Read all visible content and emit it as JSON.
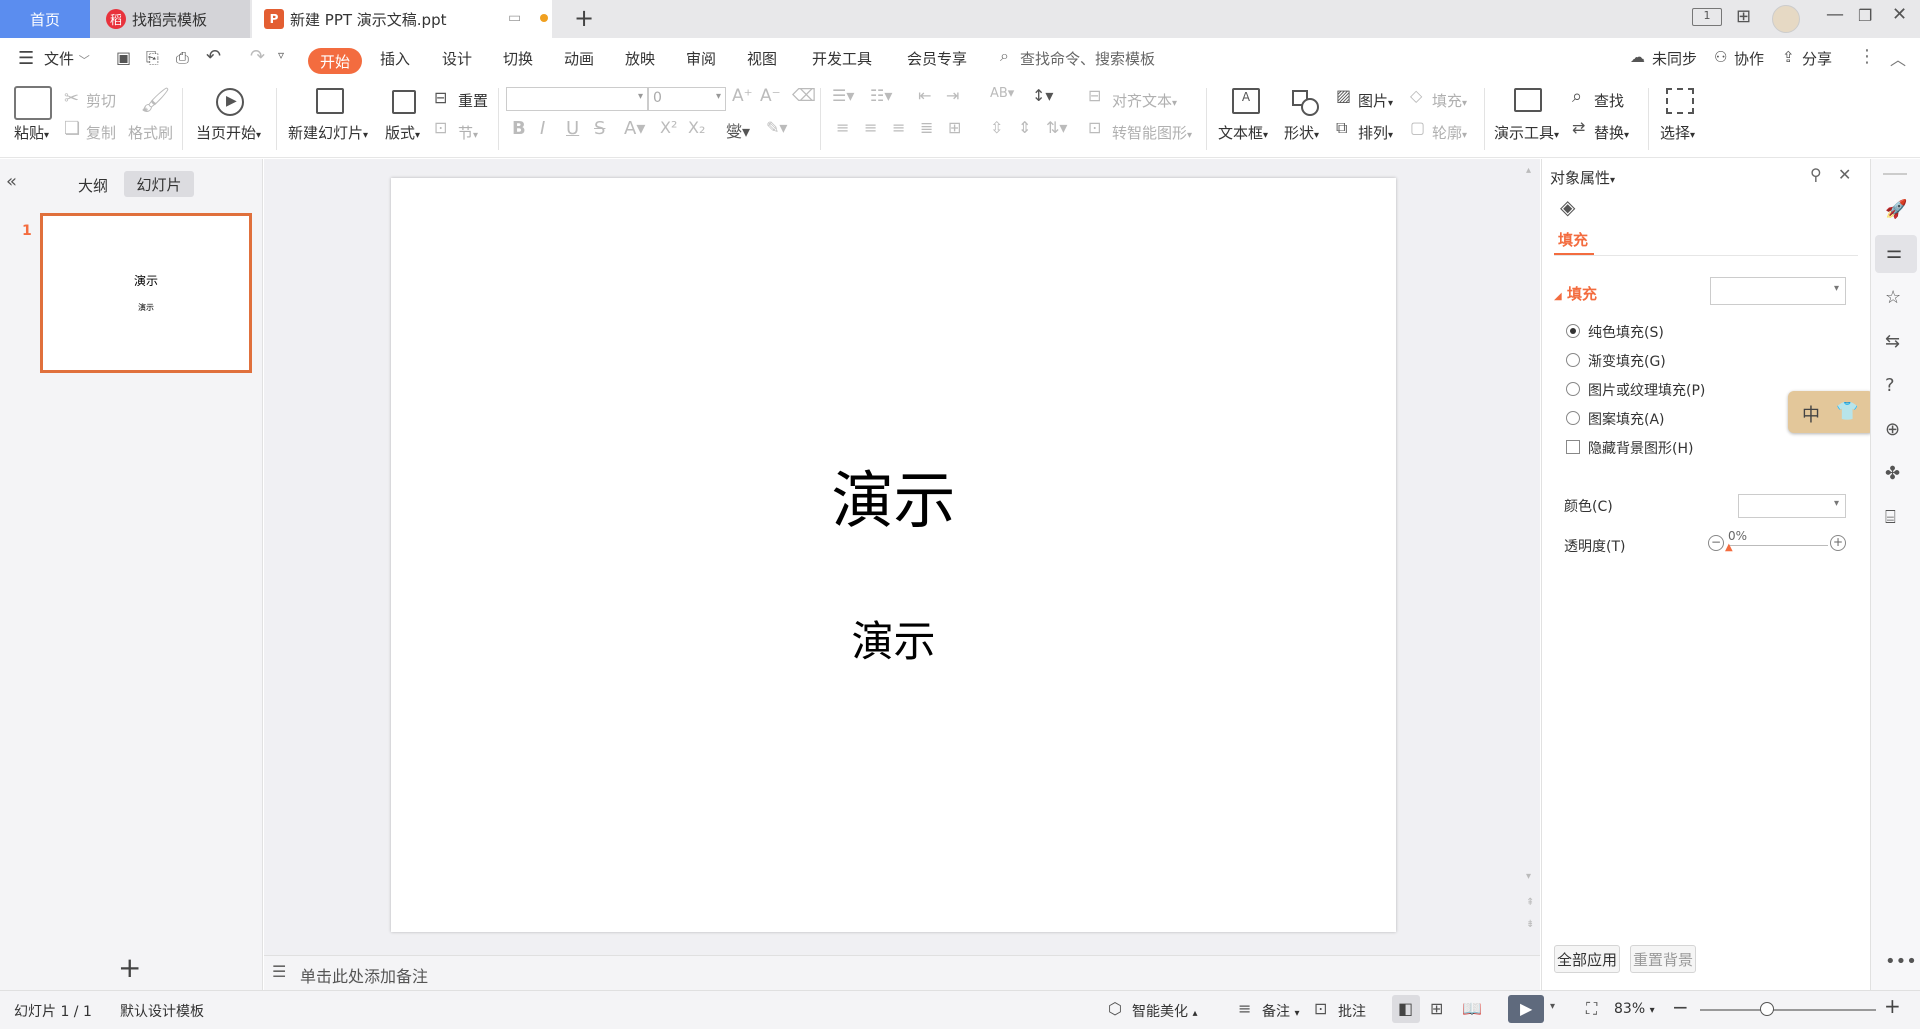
{
  "tabs": {
    "home": "首页",
    "docer": "找稻壳模板",
    "document": "新建 PPT 演示文稿.ppt"
  },
  "menu": {
    "file": "文件",
    "items": [
      "开始",
      "插入",
      "设计",
      "切换",
      "动画",
      "放映",
      "审阅",
      "视图",
      "开发工具",
      "会员专享"
    ],
    "search": "查找命令、搜索模板",
    "sync": "未同步",
    "collab": "协作",
    "share": "分享"
  },
  "ribbon": {
    "paste": "粘贴",
    "cut": "剪切",
    "copy": "复制",
    "format_painter": "格式刷",
    "from_current": "当页开始",
    "new_slide": "新建幻灯片",
    "layout": "版式",
    "section": "节",
    "reset": "重置",
    "font_size": "0",
    "align_text": "对齐文本",
    "smartart": "转智能图形",
    "textbox": "文本框",
    "shape": "形状",
    "arrange": "排列",
    "picture": "图片",
    "fill": "填充",
    "outline": "轮廓",
    "present_tools": "演示工具",
    "find": "查找",
    "replace": "替换",
    "select": "选择"
  },
  "left_panel": {
    "outline_tab": "大纲",
    "slides_tab": "幻灯片",
    "slide_number": "1",
    "thumb_title": "演示",
    "thumb_subtitle": "演示"
  },
  "slide": {
    "title": "演示",
    "subtitle": "演示"
  },
  "notes": {
    "placeholder": "单击此处添加备注"
  },
  "panel": {
    "header": "对象属性",
    "fill_tab": "填充",
    "fill_section": "填充",
    "options": [
      "纯色填充(S)",
      "渐变填充(G)",
      "图片或纹理填充(P)",
      "图案填充(A)"
    ],
    "selected_option": 0,
    "hide_bg": "隐藏背景图形(H)",
    "color_label": "颜色(C)",
    "transparency_label": "透明度(T)",
    "transparency_value": "0%",
    "apply_all": "全部应用",
    "reset_bg": "重置背景"
  },
  "ime": {
    "label": "中"
  },
  "status": {
    "slide_counter": "幻灯片 1 / 1",
    "template": "默认设计模板",
    "beautify": "智能美化",
    "notes": "备注",
    "comments": "批注",
    "zoom": "83%"
  },
  "colors": {
    "accent": "#f36c3f",
    "home_tab": "#5b8def"
  }
}
